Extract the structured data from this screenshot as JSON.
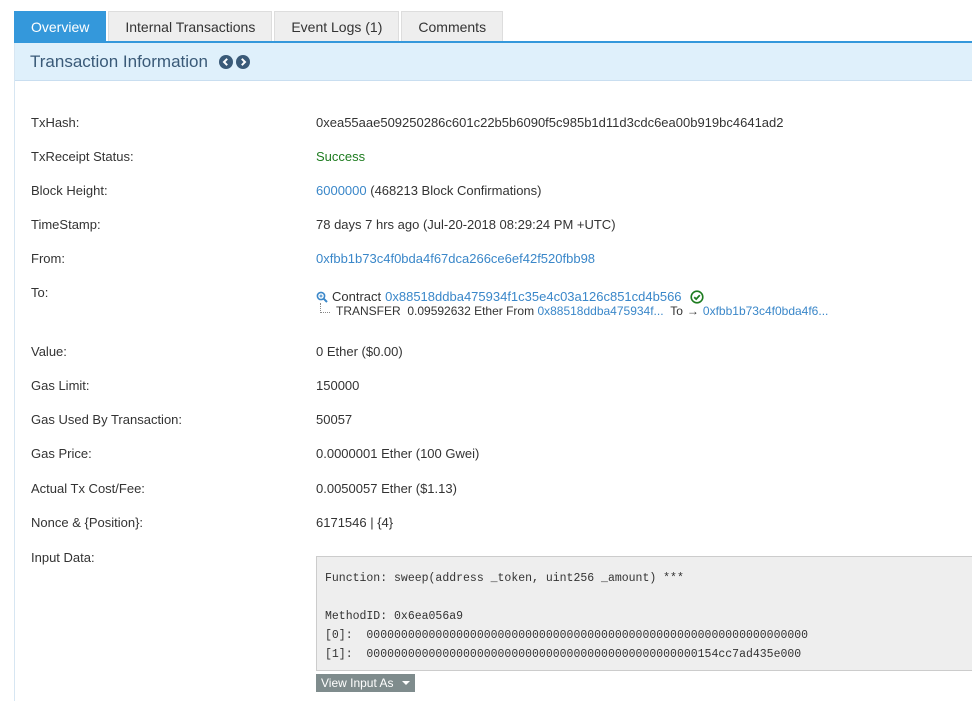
{
  "tabs": [
    {
      "label": "Overview",
      "active": true
    },
    {
      "label": "Internal Transactions",
      "active": false
    },
    {
      "label": "Event Logs (1)",
      "active": false
    },
    {
      "label": "Comments",
      "active": false
    }
  ],
  "panel": {
    "title": "Transaction Information"
  },
  "fields": {
    "txhash": {
      "label": "TxHash:",
      "value": "0xea55aae509250286c601c22b5b6090f5c985b1d11d3cdc6ea00b919bc4641ad2"
    },
    "status": {
      "label": "TxReceipt Status:",
      "value": "Success"
    },
    "block": {
      "label": "Block Height:",
      "link": "6000000",
      "suffix": " (468213 Block Confirmations)"
    },
    "timestamp": {
      "label": "TimeStamp:",
      "value": "78 days 7 hrs ago (Jul-20-2018 08:29:24 PM +UTC)"
    },
    "from": {
      "label": "From:",
      "value": "0xfbb1b73c4f0bda4f67dca266ce6ef42f520fbb98"
    },
    "to": {
      "label": "To:",
      "prefix": "Contract",
      "contract": "0x88518ddba475934f1c35e4c03a126c851cd4b566",
      "transfer_label": "TRANSFER",
      "transfer_amount": "0.09592632 Ether From",
      "transfer_from": "0x88518ddba475934f...",
      "transfer_to_label": "To",
      "transfer_to": "0xfbb1b73c4f0bda4f6..."
    },
    "value": {
      "label": "Value:",
      "value": "0 Ether ($0.00)"
    },
    "gas_limit": {
      "label": "Gas Limit:",
      "value": "150000"
    },
    "gas_used": {
      "label": "Gas Used By Transaction:",
      "value": "50057"
    },
    "gas_price": {
      "label": "Gas Price:",
      "value": "0.0000001 Ether (100 Gwei)"
    },
    "tx_cost": {
      "label": "Actual Tx Cost/Fee:",
      "value": "0.0050057 Ether ($1.13)"
    },
    "nonce": {
      "label": "Nonce & {Position}:",
      "value": "6171546 | {4}"
    },
    "input": {
      "label": "Input Data:",
      "function": "Function: sweep(address _token, uint256 _amount) ***",
      "method_id": "MethodID: 0x6ea056a9",
      "param0": "[0]:  0000000000000000000000000000000000000000000000000000000000000000",
      "param1": "[1]:  000000000000000000000000000000000000000000000000154cc7ad435e000",
      "view_as": "View Input As"
    }
  },
  "icons": {
    "prev": "chevron-left-circle",
    "next": "chevron-right-circle",
    "contract": "magnifier",
    "verified": "check-circle",
    "arrow": "→"
  },
  "colors": {
    "accent": "#3498db",
    "link": "#3a87c9",
    "success": "#1e7c20",
    "header_bg": "#dff0fb"
  }
}
